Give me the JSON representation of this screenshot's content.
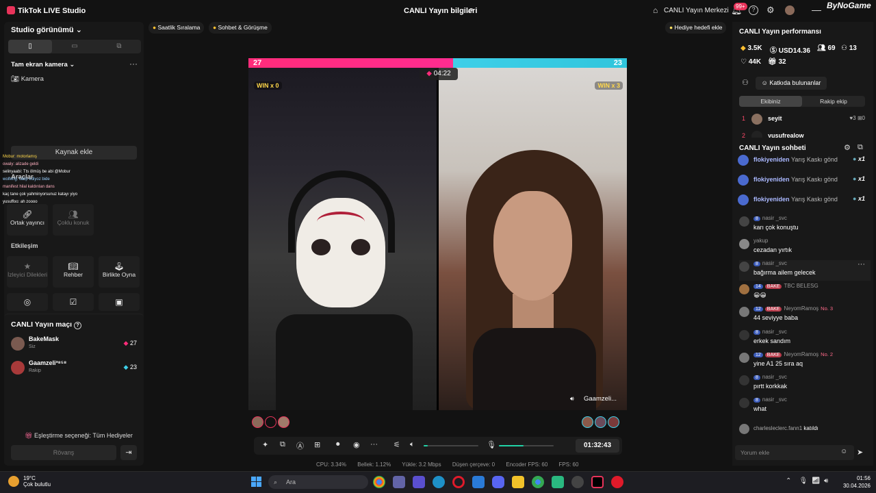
{
  "titlebar": {
    "app_name": "TikTok LIVE Studio",
    "live_info": "CANLI Yayın bilgileri",
    "live_center": "CANLI Yayın Merkezi",
    "notif_badge": "99+",
    "watermark": "ByNoGame"
  },
  "left": {
    "studio_view": "Studio görünümü",
    "fullscreen_camera": "Tam ekran kamera",
    "camera": "Kamera",
    "add_source": "Kaynak ekle",
    "tools_title": "Araçlar",
    "tools": [
      "Ortak yayıncı",
      "Çoklu konuk"
    ],
    "interaction_title": "Etkileşim",
    "interaction": [
      "İzleyici Dilekleri",
      "Rehber",
      "Birlikte Oyna"
    ],
    "overlay_chat": [
      "Mobur: motorlamış",
      "owaly: alizade geldi",
      "selinyaabi: Tts ölmüş be abi @Mobur",
      "wolfeng: takip ediyoz bide",
      "manifest hilal kaldırılan dans",
      "kaç tane çok yahminyorsunuz katayı yiyo",
      "yusuffoo: ah zoooo"
    ],
    "match_title": "CANLI Yayın maçı",
    "players": [
      {
        "name": "BakeMask",
        "sub": "Siz",
        "score": "27"
      },
      {
        "name": "Gaamzeli³⁸⁵⁸",
        "sub": "Rakip",
        "score": "23"
      }
    ],
    "match_option": "Eşleştirme seçeneği: Tüm Hediyeler",
    "rematch": "Rövanş"
  },
  "top_chips": {
    "hourly": "Saatlik Sıralama",
    "chat_meet": "Sohbet & Görüşme",
    "gift_goal": "Hediye hedefi ekle"
  },
  "battle": {
    "score_left": "27",
    "score_right": "23",
    "win_left": "WIN x 0",
    "win_right": "WIN x 3",
    "timer": "04:22",
    "opponent_name": "Gaamzeli...",
    "score_share_left": 0.54
  },
  "controls": {
    "elapsed": "01:32:43",
    "volume_level": 0.08,
    "mic_level": 0.45
  },
  "stats": {
    "cpu": "CPU: 3.34%",
    "memory": "Bellek: 1.12%",
    "upload": "Yükle: 3.2 Mbps",
    "dropped": "Düşen çerçeve: 0",
    "encoder_fps": "Encoder FPS: 60",
    "fps": "FPS: 60"
  },
  "right": {
    "perf_title": "CANLI Yayın performansı",
    "coins": "3.5K",
    "usd": "USD14.36",
    "viewers": "69",
    "new_followers": "13",
    "likes": "44K",
    "gifters": "32",
    "contributors": "Katkıda bulunanlar",
    "tab_team": "Ekibiniz",
    "tab_rival": "Rakip ekip",
    "ranks": [
      {
        "rank": "1",
        "name": "seyit",
        "likes": "3",
        "gifts": "0"
      },
      {
        "rank": "2",
        "name": "yusufrealow",
        "likes": "",
        "gifts": ""
      }
    ],
    "chat_title": "CANLI Yayın sohbeti",
    "gift_rows": [
      {
        "name": "flokiyeniden",
        "text": "Yarış Kaskı gönd",
        "count": "x1"
      },
      {
        "name": "flokiyeniden",
        "text": "Yarış Kaskı gönd",
        "count": "x1"
      },
      {
        "name": "flokiyeniden",
        "text": "Yarış Kaskı gönd",
        "count": "x1"
      }
    ],
    "messages": [
      {
        "lvl": "8",
        "fan": "",
        "user": "nasir _svc",
        "no": "",
        "text": "karı çok konuştu"
      },
      {
        "lvl": "",
        "fan": "",
        "user": "yakup",
        "no": "",
        "text": "cezadan yırtık"
      },
      {
        "lvl": "8",
        "fan": "",
        "user": "nasir _svc",
        "no": "",
        "text": "bağırma ailem gelecek"
      },
      {
        "lvl": "14",
        "fan": "BAKE",
        "user": "TBC BELESG",
        "no": "",
        "text": "😀😀"
      },
      {
        "lvl": "12",
        "fan": "BAKE",
        "user": "NeyomRamoş",
        "no": "No. 3",
        "text": "44 seviyye baba"
      },
      {
        "lvl": "8",
        "fan": "",
        "user": "nasir _svc",
        "no": "",
        "text": "erkek sandım"
      },
      {
        "lvl": "12",
        "fan": "BAKE",
        "user": "NeyomRamoş",
        "no": "No. 2",
        "text": "yine A1 25 sıra aq"
      },
      {
        "lvl": "8",
        "fan": "",
        "user": "nasir _svc",
        "no": "",
        "text": "pırtt korkkak"
      },
      {
        "lvl": "8",
        "fan": "",
        "user": "nasir _svc",
        "no": "",
        "text": "what"
      }
    ],
    "joined_user": "charlesleclerc.fann1",
    "joined_text": "katıldı",
    "comment_placeholder": "Yorum ekle"
  },
  "taskbar": {
    "temp": "19°C",
    "weather": "Çok bulutlu",
    "search": "Ara",
    "time": "01:56",
    "date": "30.04.2026"
  },
  "colors": {
    "pink": "#ff2c7a",
    "cyan": "#3ecfe8",
    "accent": "#21d4a8"
  }
}
